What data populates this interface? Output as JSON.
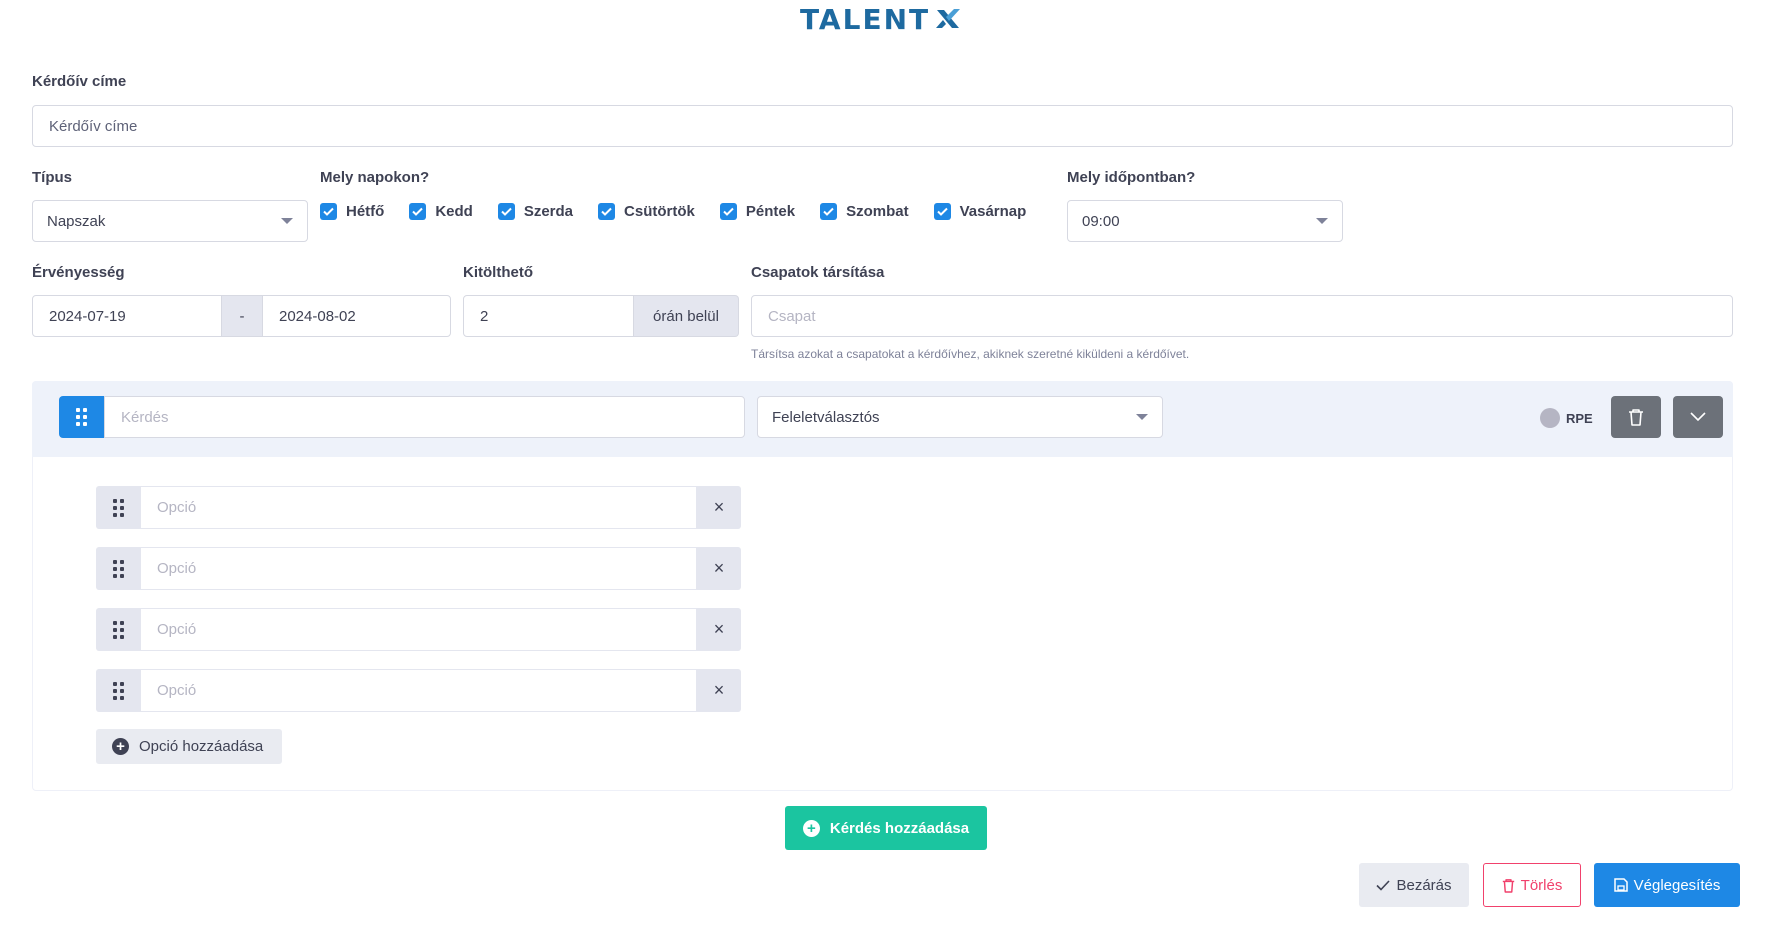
{
  "brand": {
    "logo_text": "TALENT",
    "accent": "#1e6aa0"
  },
  "form": {
    "title_label": "Kérdőív címe",
    "title_placeholder": "Kérdőív címe",
    "type_label": "Típus",
    "type_value": "Napszak",
    "days_label": "Mely napokon?",
    "days": [
      {
        "label": "Hétfő",
        "checked": true
      },
      {
        "label": "Kedd",
        "checked": true
      },
      {
        "label": "Szerda",
        "checked": true
      },
      {
        "label": "Csütörtök",
        "checked": true
      },
      {
        "label": "Péntek",
        "checked": true
      },
      {
        "label": "Szombat",
        "checked": true
      },
      {
        "label": "Vasárnap",
        "checked": true
      }
    ],
    "time_label": "Mely időpontban?",
    "time_value": "09:00",
    "validity_label": "Érvényesség",
    "validity_from": "2024-07-19",
    "validity_sep": "-",
    "validity_to": "2024-08-02",
    "fillable_label": "Kitölthető",
    "fillable_value": "2",
    "fillable_suffix": "órán belül",
    "teams_label": "Csapatok társítása",
    "teams_placeholder": "Csapat",
    "teams_hint": "Társítsa azokat a csapatokat a kérdőívhez, akiknek szeretné kiküldeni a kérdőívet."
  },
  "question": {
    "placeholder": "Kérdés",
    "type_value": "Feleletválasztós",
    "rpe_label": "RPE",
    "options": [
      {
        "placeholder": "Opció",
        "remove": "×"
      },
      {
        "placeholder": "Opció",
        "remove": "×"
      },
      {
        "placeholder": "Opció",
        "remove": "×"
      },
      {
        "placeholder": "Opció",
        "remove": "×"
      }
    ],
    "add_option_label": "Opció hozzáadása"
  },
  "actions": {
    "add_question_label": "Kérdés hozzáadása",
    "close_label": "Bezárás",
    "delete_label": "Törlés",
    "finalize_label": "Véglegesítés"
  },
  "colors": {
    "primary": "#1e88e5",
    "success": "#1bc5a0",
    "danger": "#f1416c",
    "dark_button": "#6c7179"
  }
}
